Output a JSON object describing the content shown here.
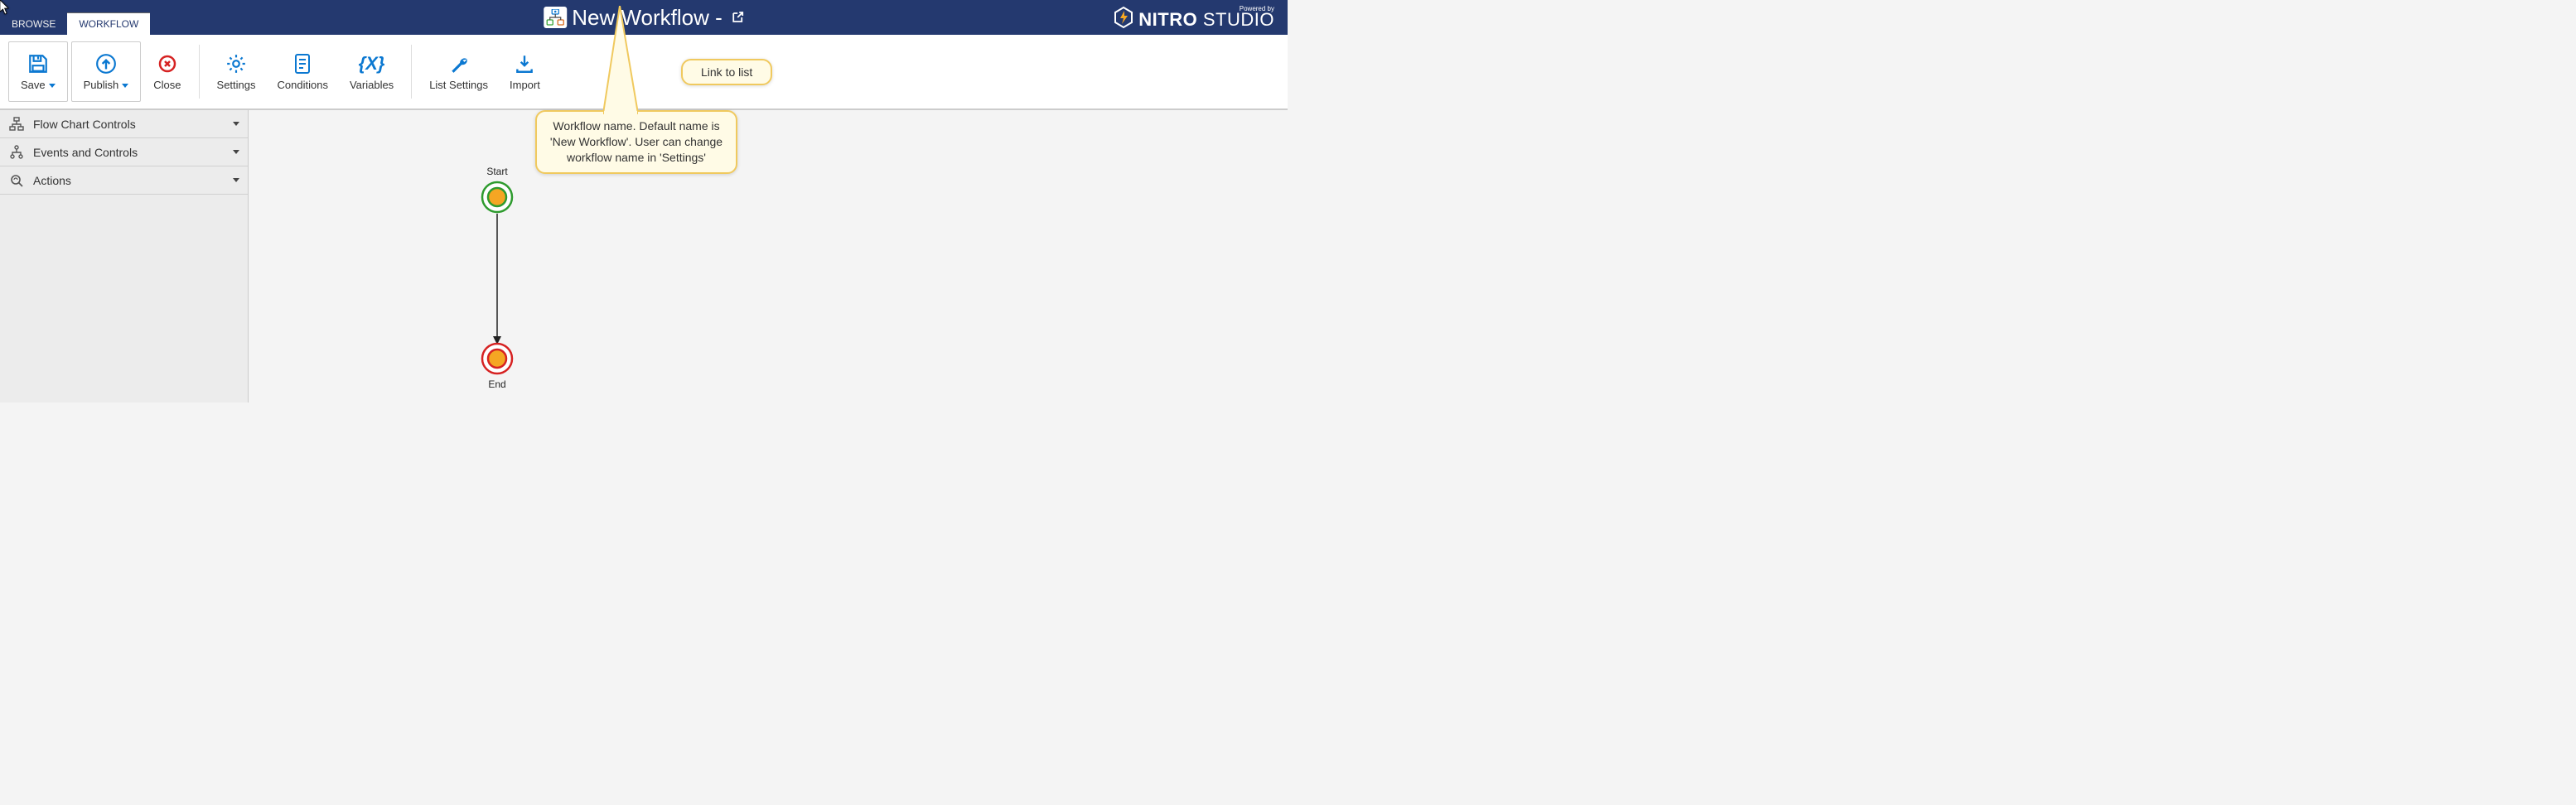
{
  "header": {
    "tabs": [
      "BROWSE",
      "WORKFLOW"
    ],
    "active_tab": 1,
    "title": "New Workflow -",
    "brand_main": "NITRO",
    "brand_sub": "STUDIO",
    "brand_powered": "Powered by"
  },
  "ribbon": {
    "save": "Save",
    "publish": "Publish",
    "close": "Close",
    "settings": "Settings",
    "conditions": "Conditions",
    "variables": "Variables",
    "list_settings": "List Settings",
    "import": "Import"
  },
  "sidebar": [
    {
      "label": "Flow Chart Controls",
      "icon": "flowchart"
    },
    {
      "label": "Events and Controls",
      "icon": "events"
    },
    {
      "label": "Actions",
      "icon": "actions"
    }
  ],
  "diagram": {
    "start_label": "Start",
    "end_label": "End"
  },
  "callouts": {
    "workflow_name": "Workflow name. Default name is 'New Workflow'. User can change workflow name in 'Settings'",
    "link_to_list": "Link to list"
  }
}
